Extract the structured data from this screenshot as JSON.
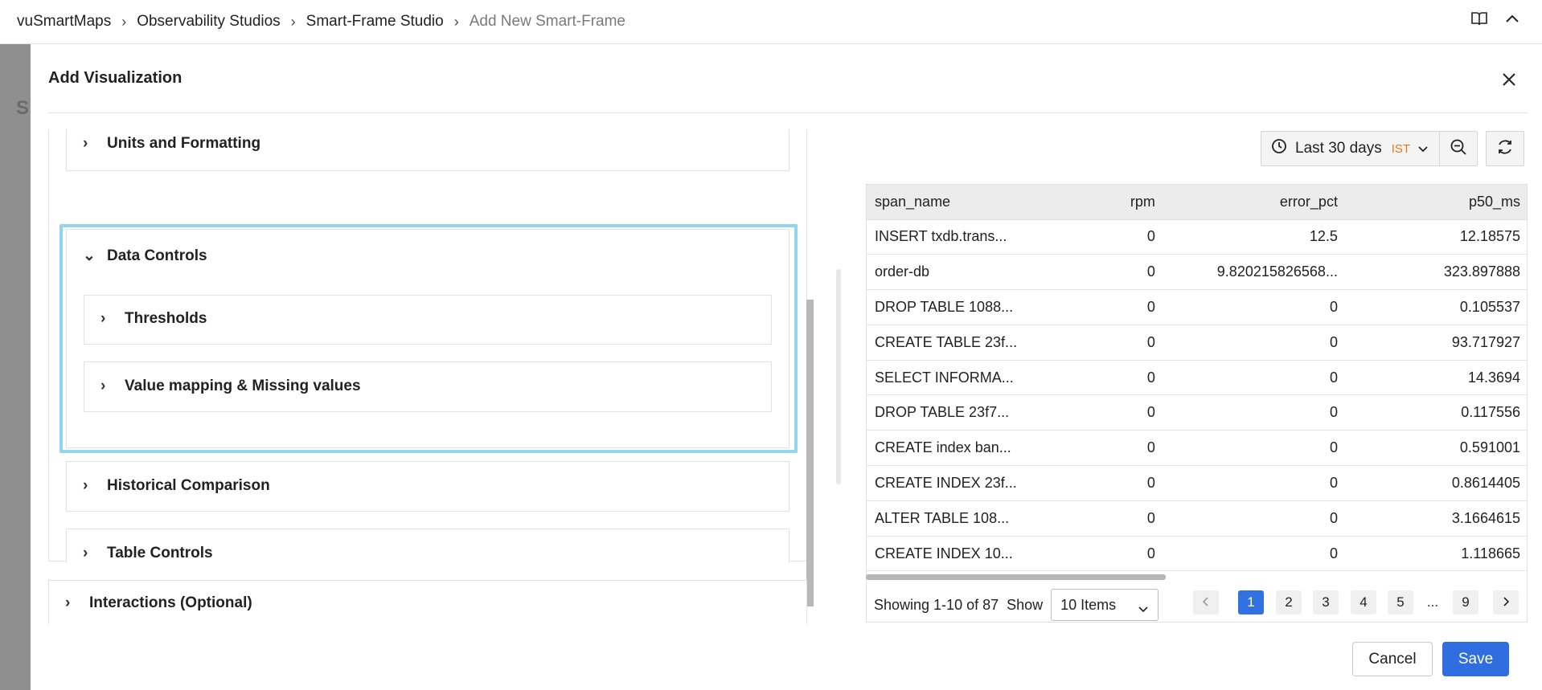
{
  "breadcrumb": {
    "items": [
      "vuSmartMaps",
      "Observability Studios",
      "Smart-Frame Studio"
    ],
    "current": "Add New Smart-Frame"
  },
  "backdrop": {
    "letter": "S"
  },
  "modal": {
    "title": "Add Visualization",
    "sections": {
      "units": "Units and Formatting",
      "data_controls": "Data Controls",
      "thresholds": "Thresholds",
      "value_mapping": "Value mapping & Missing values",
      "historical": "Historical Comparison",
      "table_controls": "Table Controls",
      "interactions": "Interactions (Optional)"
    },
    "time_picker": {
      "label": "Last 30 days",
      "timezone": "IST"
    },
    "table": {
      "columns": [
        "span_name",
        "rpm",
        "error_pct",
        "p50_ms"
      ],
      "rows": [
        [
          "INSERT txdb.trans...",
          "0",
          "12.5",
          "12.18575"
        ],
        [
          "order-db",
          "0",
          "9.820215826568...",
          "323.897888"
        ],
        [
          "DROP TABLE 1088...",
          "0",
          "0",
          "0.105537"
        ],
        [
          "CREATE TABLE 23f...",
          "0",
          "0",
          "93.717927"
        ],
        [
          "SELECT INFORMA...",
          "0",
          "0",
          "14.3694"
        ],
        [
          "DROP TABLE 23f7...",
          "0",
          "0",
          "0.117556"
        ],
        [
          "CREATE index ban...",
          "0",
          "0",
          "0.591001"
        ],
        [
          "CREATE INDEX 23f...",
          "0",
          "0",
          "0.8614405"
        ],
        [
          "ALTER TABLE 108...",
          "0",
          "0",
          "3.1664615"
        ],
        [
          "CREATE INDEX 10...",
          "0",
          "0",
          "1.118665"
        ]
      ]
    },
    "pagination": {
      "showing": "Showing 1-10 of 87",
      "show_label": "Show",
      "items_value": "10 Items",
      "pages": [
        "1",
        "2",
        "3",
        "4",
        "5"
      ],
      "ellipsis": "...",
      "last_page": "9",
      "active_page": "1"
    },
    "footer": {
      "cancel": "Cancel",
      "save": "Save"
    },
    "colors": {
      "primary": "#2f6de0",
      "focus": "#8fd6ef",
      "timezone": "#e07b1a"
    }
  }
}
